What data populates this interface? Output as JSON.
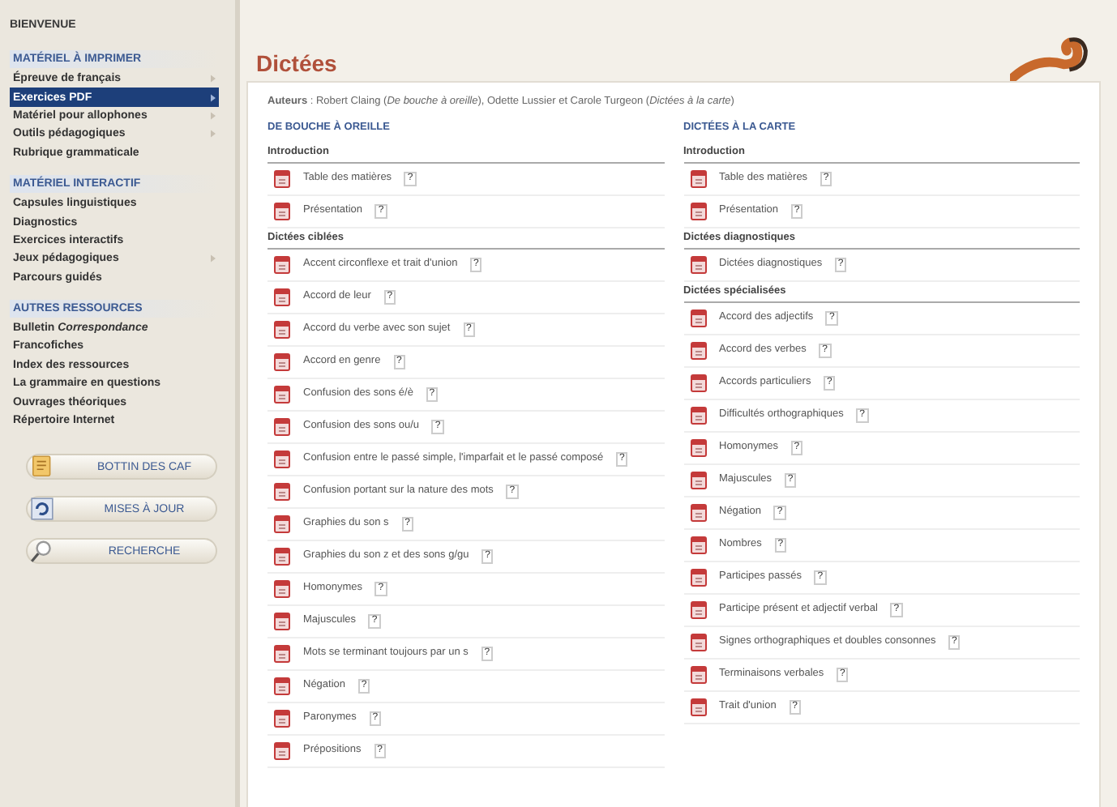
{
  "sidebar": {
    "greeting": "BIENVENUE",
    "sections": [
      {
        "title": "MATÉRIEL À IMPRIMER",
        "items": [
          {
            "label": "Épreuve de français",
            "selected": false,
            "submenu": true
          },
          {
            "label": "Exercices PDF",
            "selected": true,
            "submenu": true
          },
          {
            "label": "Matériel pour allophones",
            "selected": false,
            "submenu": true
          },
          {
            "label": "Outils pédagogiques",
            "selected": false,
            "submenu": true
          },
          {
            "label": "Rubrique grammaticale",
            "selected": false,
            "submenu": false
          }
        ]
      },
      {
        "title": "MATÉRIEL INTERACTIF",
        "items": [
          {
            "label": "Capsules linguistiques",
            "selected": false,
            "submenu": false
          },
          {
            "label": "Diagnostics",
            "selected": false,
            "submenu": false
          },
          {
            "label": "Exercices interactifs",
            "selected": false,
            "submenu": false
          },
          {
            "label": "Jeux pédagogiques",
            "selected": false,
            "submenu": true
          },
          {
            "label": "Parcours guidés",
            "selected": false,
            "submenu": false
          }
        ]
      },
      {
        "title": "AUTRES RESSOURCES",
        "items": [
          {
            "label": "Bulletin *Correspondance*",
            "selected": false,
            "submenu": false
          },
          {
            "label": "Francofiches",
            "selected": false,
            "submenu": false
          },
          {
            "label": "Index des ressources",
            "selected": false,
            "submenu": false
          },
          {
            "label": "La grammaire en questions",
            "selected": false,
            "submenu": false
          },
          {
            "label": "Ouvrages théoriques",
            "selected": false,
            "submenu": false
          },
          {
            "label": "Répertoire Internet",
            "selected": false,
            "submenu": false
          }
        ]
      }
    ],
    "buttons": [
      {
        "label": "BOTTIN DES CAF",
        "kind": "folder"
      },
      {
        "label": "MISES À JOUR",
        "kind": "refresh"
      },
      {
        "label": "RECHERCHE",
        "kind": "search"
      }
    ]
  },
  "content": {
    "title": "Dictées",
    "authors": "**Auteurs** : Robert Claing (*De bouche à oreille*), Odette Lussier et Carole Turgeon (*Dictées à la carte*)",
    "columns": [
      {
        "heading": "DE BOUCHE À OREILLE",
        "groups": [
          {
            "title": "Introduction",
            "items": [
              {
                "label": "Table des matières",
                "help": "?"
              },
              {
                "label": "Présentation",
                "help": "?"
              }
            ]
          },
          {
            "title": "Dictées ciblées",
            "items": [
              {
                "label": "Accent circonflexe et trait d'union",
                "help": "?"
              },
              {
                "label": "Accord de leur",
                "help": "?"
              },
              {
                "label": "Accord du verbe avec son sujet",
                "help": "?"
              },
              {
                "label": "Accord en genre",
                "help": "?"
              },
              {
                "label": "Confusion des sons é/è",
                "help": "?"
              },
              {
                "label": "Confusion des sons ou/u",
                "help": "?"
              },
              {
                "label": "Confusion entre le passé simple, l'imparfait et le passé composé",
                "help": "?"
              },
              {
                "label": "Confusion portant sur la nature des mots",
                "help": "?"
              },
              {
                "label": "Graphies du son s",
                "help": "?"
              },
              {
                "label": "Graphies du son z et des sons g/gu",
                "help": "?"
              },
              {
                "label": "Homonymes",
                "help": "?"
              },
              {
                "label": "Majuscules",
                "help": "?"
              },
              {
                "label": "Mots se terminant toujours par un s",
                "help": "?"
              },
              {
                "label": "Négation",
                "help": "?"
              },
              {
                "label": "Paronymes",
                "help": "?"
              },
              {
                "label": "Prépositions",
                "help": "?"
              }
            ]
          }
        ]
      },
      {
        "heading": "DICTÉES À LA CARTE",
        "groups": [
          {
            "title": "Introduction",
            "items": [
              {
                "label": "Table des matières",
                "help": "?"
              },
              {
                "label": "Présentation",
                "help": "?"
              }
            ]
          },
          {
            "title": "Dictées diagnostiques",
            "items": [
              {
                "label": "Dictées diagnostiques",
                "help": "?"
              }
            ]
          },
          {
            "title": "Dictées spécialisées",
            "items": [
              {
                "label": "Accord des adjectifs",
                "help": "?"
              },
              {
                "label": "Accord des verbes",
                "help": "?"
              },
              {
                "label": "Accords particuliers",
                "help": "?"
              },
              {
                "label": "Difficultés orthographiques",
                "help": "?"
              },
              {
                "label": "Homonymes",
                "help": "?"
              },
              {
                "label": "Majuscules",
                "help": "?"
              },
              {
                "label": "Négation",
                "help": "?"
              },
              {
                "label": "Nombres",
                "help": "?"
              },
              {
                "label": "Participes passés",
                "help": "?"
              },
              {
                "label": "Participe présent et adjectif verbal",
                "help": "?"
              },
              {
                "label": "Signes orthographiques et doubles consonnes",
                "help": "?"
              },
              {
                "label": "Terminaisons verbales",
                "help": "?"
              },
              {
                "label": "Trait d'union",
                "help": "?"
              }
            ]
          }
        ]
      }
    ]
  }
}
